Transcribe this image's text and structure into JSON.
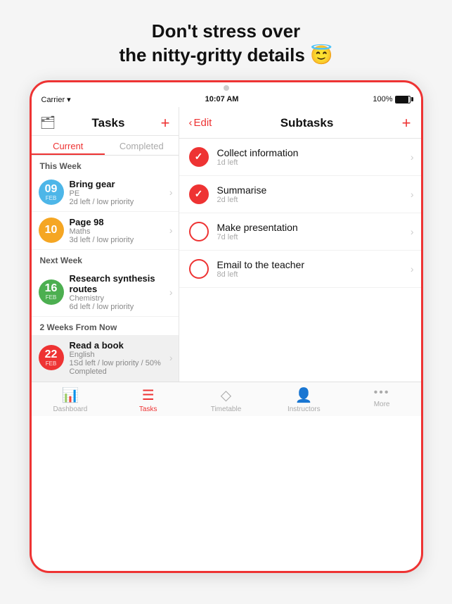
{
  "headline": {
    "line1": "Don't stress over",
    "line2": "the nitty-gritty details 😇"
  },
  "status_bar": {
    "carrier": "Carrier ▾",
    "time": "10:07 AM",
    "battery": "100%"
  },
  "left_panel": {
    "title": "Tasks",
    "tabs": [
      "Current",
      "Completed"
    ],
    "active_tab": "Current",
    "sections": [
      {
        "label": "This Week",
        "items": [
          {
            "num": "09",
            "month": "Feb",
            "color": "#4db6e8",
            "title": "Bring gear",
            "sub": "PE",
            "meta": "2d left / low priority"
          },
          {
            "num": "10",
            "month": "",
            "color": "#f5a623",
            "title": "Page 98",
            "sub": "Maths",
            "meta": "3d left / low priority"
          }
        ]
      },
      {
        "label": "Next Week",
        "items": [
          {
            "num": "16",
            "month": "Feb",
            "color": "#4caf50",
            "title": "Research synthesis routes",
            "sub": "Chemistry",
            "meta": "6d left / low priority"
          }
        ]
      },
      {
        "label": "2 Weeks From Now",
        "items": [
          {
            "num": "22",
            "month": "Feb",
            "color": "#e33",
            "title": "Read a book",
            "sub": "English",
            "meta": "1Sd left / low priority / 50% Completed",
            "selected": true
          }
        ]
      }
    ]
  },
  "right_panel": {
    "title": "Subtasks",
    "edit_label": "Edit",
    "subtasks": [
      {
        "title": "Collect information",
        "meta": "1d left",
        "checked": true
      },
      {
        "title": "Summarise",
        "meta": "2d left",
        "checked": true
      },
      {
        "title": "Make presentation",
        "meta": "7d left",
        "checked": false
      },
      {
        "title": "Email to the teacher",
        "meta": "8d left",
        "checked": false
      }
    ]
  },
  "bottom_nav": {
    "items": [
      {
        "icon": "📊",
        "label": "Dashboard",
        "active": false
      },
      {
        "icon": "☰",
        "label": "Tasks",
        "active": true
      },
      {
        "icon": "◇",
        "label": "Timetable",
        "active": false
      },
      {
        "icon": "👤",
        "label": "Instructors",
        "active": false
      },
      {
        "label": "More",
        "active": false,
        "is_dots": true
      }
    ]
  }
}
